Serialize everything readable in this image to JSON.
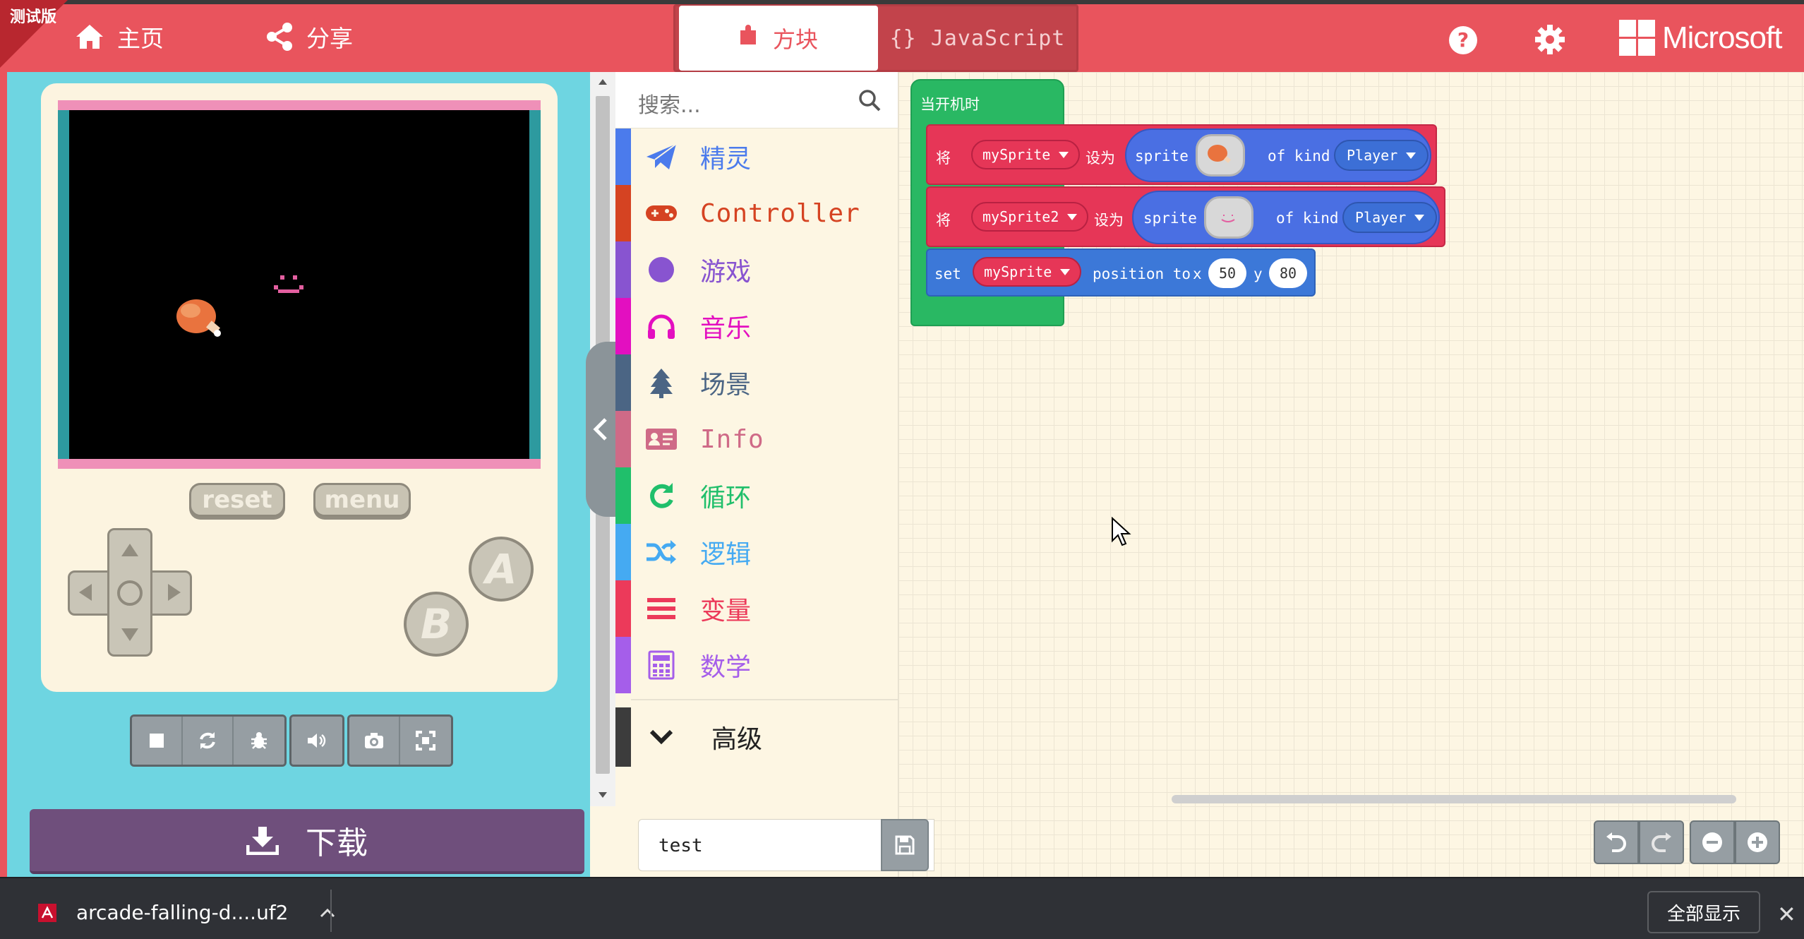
{
  "beta_label": "测试版",
  "nav": {
    "home_label": "主页",
    "share_label": "分享"
  },
  "editor_tabs": {
    "blocks_label": "方块",
    "js_label": "JavaScript",
    "active": "blocks"
  },
  "brand": {
    "name": "Microsoft"
  },
  "icons": {
    "home": "home-icon",
    "share": "share-icon",
    "help": "help-icon",
    "settings": "gear-icon"
  },
  "simulator": {
    "reset_label": "reset",
    "menu_label": "menu",
    "a_label": "A",
    "b_label": "B",
    "toolbar": [
      "stop-icon",
      "restart-icon",
      "debug-icon",
      "sound-icon",
      "screenshot-icon",
      "fullscreen-icon"
    ]
  },
  "download": {
    "label": "下载"
  },
  "toolbox": {
    "search_placeholder": "搜索...",
    "categories": [
      {
        "label": "精灵",
        "color": "#4b7bec",
        "icon": "paper-plane-icon"
      },
      {
        "label": "Controller",
        "color": "#d54322",
        "icon": "gamepad-icon"
      },
      {
        "label": "游戏",
        "color": "#8854d0",
        "icon": "circle-icon"
      },
      {
        "label": "音乐",
        "color": "#e30fc0",
        "icon": "headphones-icon"
      },
      {
        "label": "场景",
        "color": "#4b6584",
        "icon": "tree-icon"
      },
      {
        "label": "Info",
        "color": "#cf6a87",
        "icon": "id-card-icon"
      },
      {
        "label": "循环",
        "color": "#20bf6b",
        "icon": "loop-icon"
      },
      {
        "label": "逻辑",
        "color": "#45aaf2",
        "icon": "shuffle-icon"
      },
      {
        "label": "变量",
        "color": "#ec3a5a",
        "icon": "bars-icon"
      },
      {
        "label": "数学",
        "color": "#a55eea",
        "icon": "calculator-icon"
      }
    ],
    "advanced_label": "高级"
  },
  "workspace": {
    "hat_label": "当开机时",
    "block1": {
      "kw": "将",
      "var": "mySprite",
      "set": "设为",
      "sprite": "sprite",
      "of_kind": "of kind",
      "kind": "Player"
    },
    "block2": {
      "kw": "将",
      "var": "mySprite2",
      "set": "设为",
      "sprite": "sprite",
      "of_kind": "of kind",
      "kind": "Player"
    },
    "block3": {
      "set": "set",
      "var": "mySprite",
      "position_to": "position to",
      "x_label": "x",
      "x": "50",
      "y_label": "y",
      "y": "80"
    }
  },
  "project": {
    "name": "test"
  },
  "download_bar": {
    "file_name": "arcade-falling-d....uf2",
    "show_all": "全部显示"
  },
  "colors": {
    "topbar": "#e9545d",
    "simulator_bg": "#6ed5e1",
    "download_btn": "#6f4f7c",
    "hat_block": "#29b863",
    "variables_block": "#e63657",
    "sprites_block": "#4a6fe3"
  }
}
